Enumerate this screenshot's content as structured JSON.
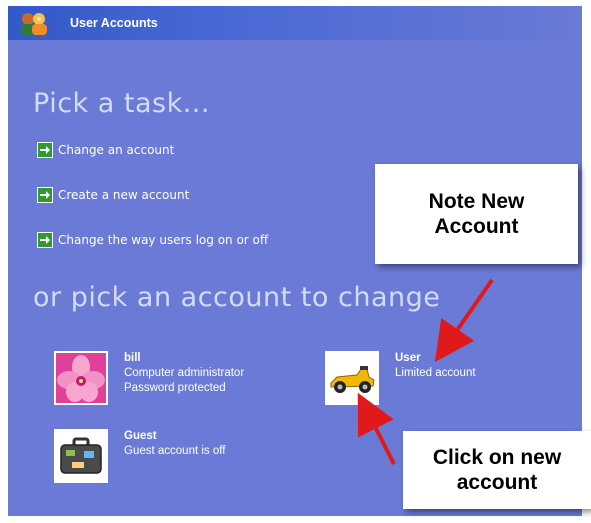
{
  "window": {
    "title": "User Accounts"
  },
  "tasks": {
    "heading": "Pick a task...",
    "items": [
      {
        "label": "Change an account"
      },
      {
        "label": "Create a new account"
      },
      {
        "label": "Change the way users log on or off"
      }
    ]
  },
  "accounts": {
    "heading": "or pick an account to change",
    "list": [
      {
        "name": "bill",
        "line1": "Computer administrator",
        "line2": "Password protected",
        "picture": "flower-icon"
      },
      {
        "name": "User",
        "line1": "Limited account",
        "line2": "",
        "picture": "race-car-icon"
      },
      {
        "name": "Guest",
        "line1": "Guest account is off",
        "line2": "",
        "picture": "suitcase-icon"
      }
    ]
  },
  "callouts": {
    "note": "Note New\nAccount",
    "click": "Click on new\naccount"
  },
  "colors": {
    "panel_bg": "#6b7ad6",
    "titlebar": "#3159c8",
    "heading_text": "#d3dbf8",
    "task_arrow": "#2f9b2f",
    "annotation_arrow": "#e01a1a"
  }
}
